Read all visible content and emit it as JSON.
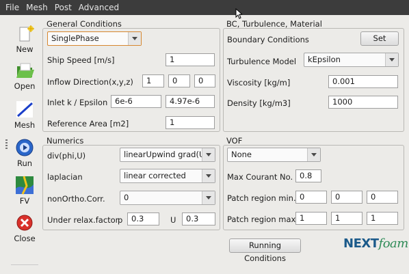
{
  "menu": [
    "File",
    "Mesh",
    "Post",
    "Advanced"
  ],
  "toolbar": [
    {
      "label": "New",
      "icon": "new-icon"
    },
    {
      "label": "Open",
      "icon": "open-folder-icon"
    },
    {
      "label": "Mesh",
      "icon": "mesh-icon"
    },
    {
      "label": "Run",
      "icon": "run-icon"
    },
    {
      "label": "FV",
      "icon": "fv-icon"
    },
    {
      "label": "Close",
      "icon": "close-icon"
    }
  ],
  "general": {
    "title": "General Conditions",
    "solver": "SinglePhase",
    "ship_speed_label": "Ship Speed [m/s]",
    "ship_speed": "1",
    "inflow_label": "Inflow Direction(x,y,z)",
    "inflow": [
      "1",
      "0",
      "0"
    ],
    "inlet_label": "Inlet k / Epsilon",
    "inlet_k": "6e-6",
    "inlet_eps": "4.97e-6",
    "ref_area_label": "Reference Area [m2]",
    "ref_area": "1"
  },
  "bc": {
    "title": "BC, Turbulence, Material",
    "boundary_label": "Boundary Conditions",
    "set_label": "Set",
    "turb_label": "Turbulence Model",
    "turb_model": "kEpsilon",
    "visc_label": "Viscosity [kg/m]",
    "viscosity": "0.001",
    "dens_label": "Density [kg/m3]",
    "density": "1000"
  },
  "numerics": {
    "title": "Numerics",
    "div_label": "div(phi,U)",
    "div": "linearUpwind grad(U)",
    "lap_label": "laplacian",
    "laplacian": "linear corrected",
    "nonortho_label": "nonOrtho.Corr.",
    "nonortho": "0",
    "relax_label": "Under relax.factor",
    "p_label": "p",
    "p": "0.3",
    "u_label": "U",
    "u": "0.3"
  },
  "vof": {
    "title": "VOF",
    "mode": "None",
    "courant_label": "Max Courant No.",
    "courant": "0.8",
    "pmin_label": "Patch region min.",
    "pmin": [
      "0",
      "0",
      "0"
    ],
    "pmax_label": "Patch region max.",
    "pmax": [
      "1",
      "1",
      "1"
    ]
  },
  "running_label": "Running Conditions",
  "logo": {
    "next": "NEXT",
    "foam": "foam"
  }
}
